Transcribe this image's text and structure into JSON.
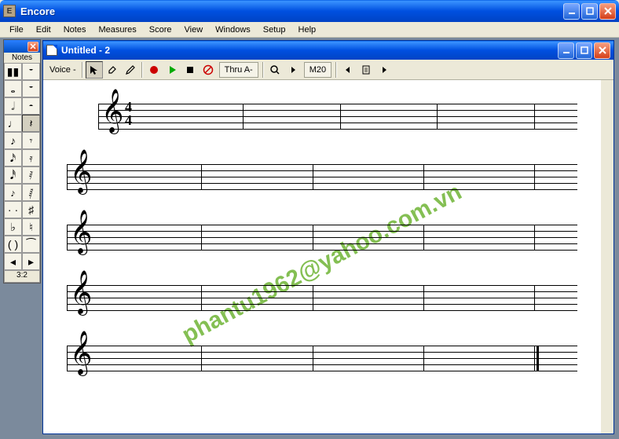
{
  "app": {
    "title": "Encore",
    "icon_letter": "E"
  },
  "menu": [
    "File",
    "Edit",
    "Notes",
    "Measures",
    "Score",
    "View",
    "Windows",
    "Setup",
    "Help"
  ],
  "palette": {
    "title": "Notes",
    "ratio": "3:2"
  },
  "document": {
    "title": "Untitled - 2"
  },
  "toolbar": {
    "voice_label": "Voice -",
    "thru_label": "Thru A-",
    "measure_label": "M20"
  },
  "score": {
    "clef": "𝄞",
    "time_top": "4",
    "time_bottom": "4",
    "systems": 5
  },
  "watermark": "phantu1962@yahoo.com.vn"
}
